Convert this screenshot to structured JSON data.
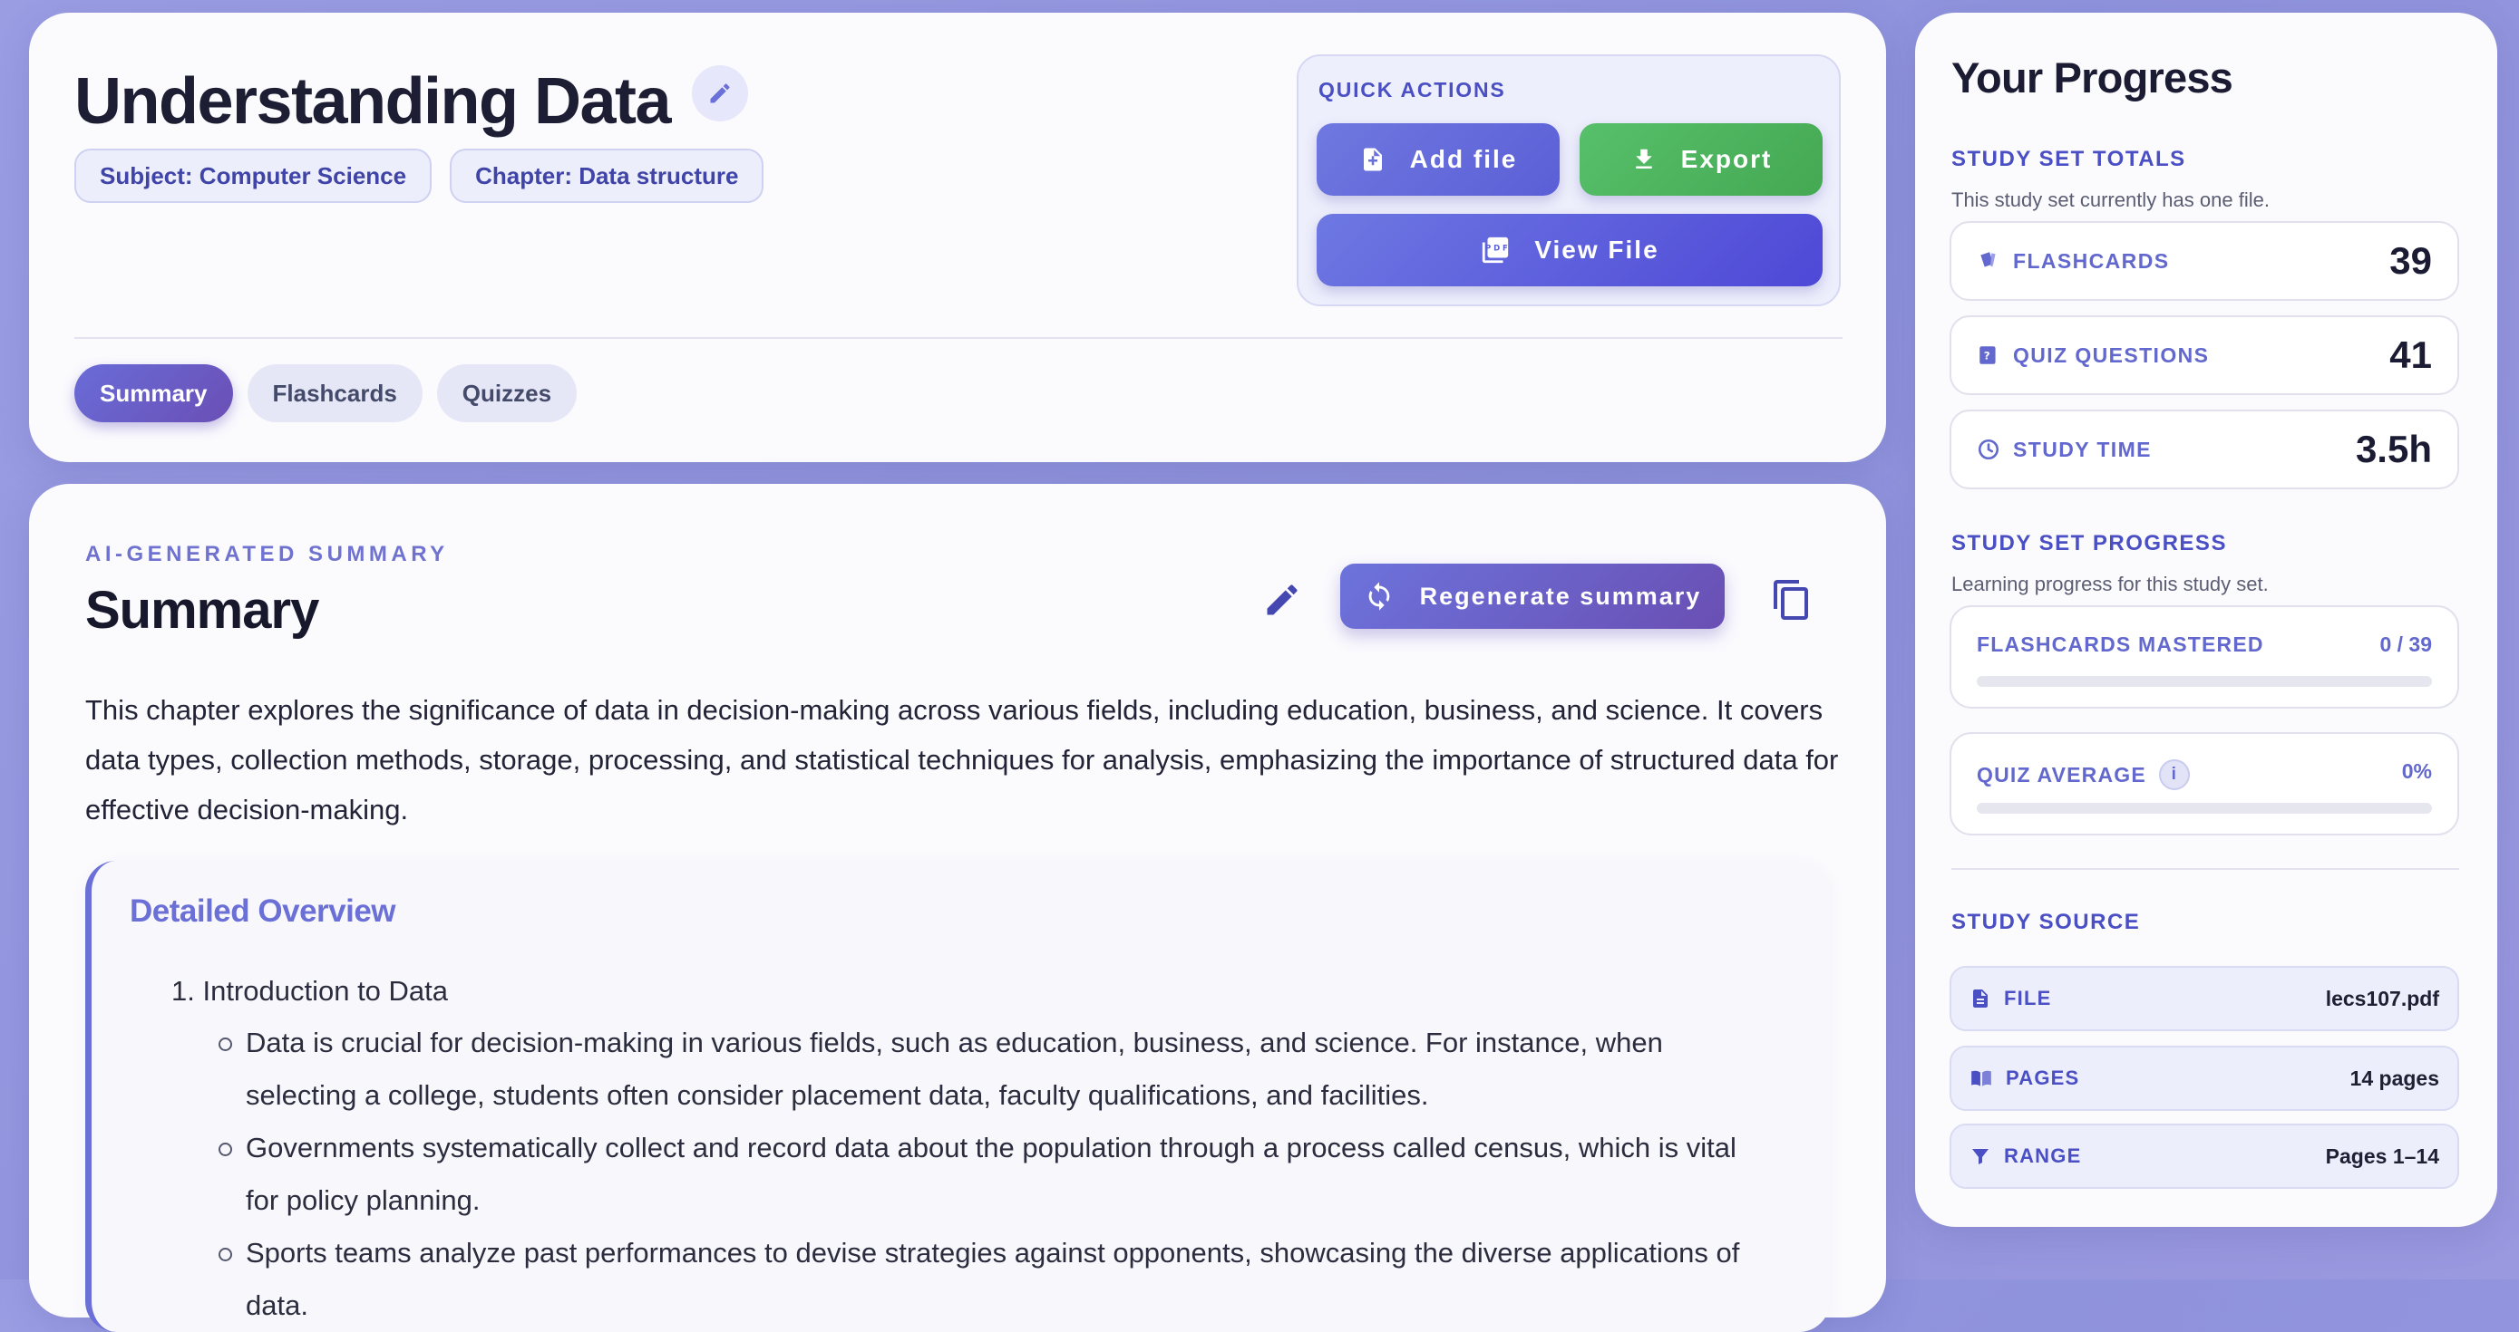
{
  "header": {
    "title": "Understanding Data",
    "chips": [
      "Subject: Computer Science",
      "Chapter: Data structure"
    ],
    "quick_actions": {
      "title": "QUICK ACTIONS",
      "add_file": "Add file",
      "export": "Export",
      "view_file": "View File"
    },
    "tabs": [
      {
        "label": "Summary",
        "active": true
      },
      {
        "label": "Flashcards",
        "active": false
      },
      {
        "label": "Quizzes",
        "active": false
      }
    ]
  },
  "summary": {
    "eyebrow": "AI-GENERATED SUMMARY",
    "heading": "Summary",
    "regenerate_label": "Regenerate summary",
    "text": "This chapter explores the significance of data in decision-making across various fields, including education, business, and science. It covers data types, collection methods, storage, processing, and statistical techniques for analysis, emphasizing the importance of structured data for effective decision-making.",
    "overview": {
      "title": "Detailed Overview",
      "item1": "1. Introduction to Data",
      "bullets": [
        "Data is crucial for decision-making in various fields, such as education, business, and science. For instance, when selecting a college, students often consider placement data, faculty qualifications, and facilities.",
        "Governments systematically collect and record data about the population through a process called census, which is vital for policy planning.",
        "Sports teams analyze past performances to devise strategies against opponents, showcasing the diverse applications of data."
      ]
    }
  },
  "progress": {
    "title": "Your Progress",
    "totals_label": "STUDY SET TOTALS",
    "totals_sub": "This study set currently has one file.",
    "stats": [
      {
        "icon": "cards-icon",
        "label": "FLASHCARDS",
        "value": "39"
      },
      {
        "icon": "quiz-icon",
        "label": "QUIZ QUESTIONS",
        "value": "41"
      },
      {
        "icon": "clock-icon",
        "label": "STUDY TIME",
        "value": "3.5h"
      }
    ],
    "progress_label": "STUDY SET PROGRESS",
    "progress_sub": "Learning progress for this study set.",
    "mastered": {
      "label": "FLASHCARDS MASTERED",
      "value": "0 / 39",
      "fraction": 0
    },
    "quiz_avg": {
      "label": "QUIZ AVERAGE",
      "info": "i",
      "value": "0%",
      "fraction": 0
    },
    "source_label": "STUDY SOURCE",
    "source": [
      {
        "icon": "file-icon",
        "label": "FILE",
        "value": "lecs107.pdf"
      },
      {
        "icon": "book-icon",
        "label": "PAGES",
        "value": "14 pages"
      },
      {
        "icon": "filter-icon",
        "label": "RANGE",
        "value": "Pages 1–14"
      }
    ]
  },
  "colors": {
    "accent": "#6a70d8",
    "success": "#4fb45f",
    "background": "#9a9de2"
  }
}
